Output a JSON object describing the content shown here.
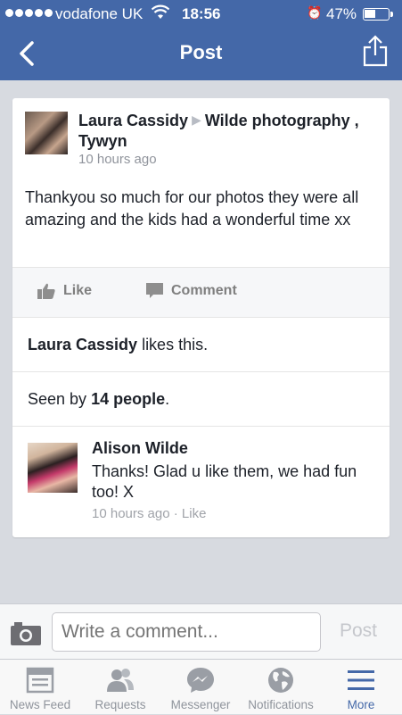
{
  "status_bar": {
    "carrier": "vodafone UK",
    "time": "18:56",
    "battery": "47%"
  },
  "nav": {
    "title": "Post"
  },
  "post": {
    "author": "Laura Cassidy",
    "target": "Wilde photography , Tywyn",
    "time": "10 hours ago",
    "text": "Thankyou so much for our photos they were all amazing and the kids had a wonderful time xx",
    "like_label": "Like",
    "comment_label": "Comment",
    "likes_name": "Laura Cassidy",
    "likes_suffix": " likes this.",
    "seen_prefix": "Seen by ",
    "seen_count": "14 people",
    "seen_suffix": "."
  },
  "comment": {
    "author": "Alison Wilde",
    "text": "Thanks! Glad u like them, we had fun too! X",
    "time": "10 hours ago",
    "separator": " · ",
    "like_label": "Like"
  },
  "composer": {
    "placeholder": "Write a comment...",
    "post_label": "Post"
  },
  "tabs": [
    {
      "label": "News Feed",
      "icon": "news-feed-icon"
    },
    {
      "label": "Requests",
      "icon": "requests-icon"
    },
    {
      "label": "Messenger",
      "icon": "messenger-icon"
    },
    {
      "label": "Notifications",
      "icon": "globe-icon"
    },
    {
      "label": "More",
      "icon": "menu-icon"
    }
  ],
  "colors": {
    "brand": "#4468a8",
    "background": "#d7dae0",
    "muted": "#90949c"
  }
}
